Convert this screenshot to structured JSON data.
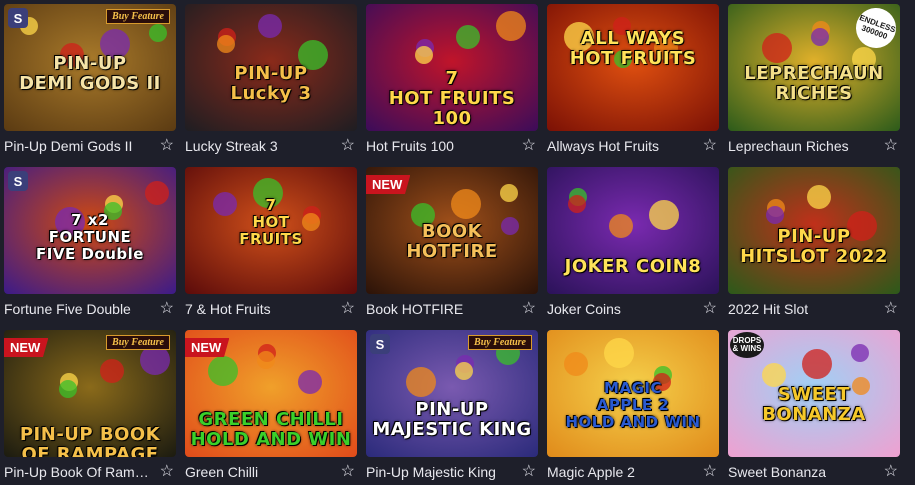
{
  "games": [
    {
      "title": "Pin-Up Demi Gods II",
      "logo": "PIN-UP\nDEMI GODS II",
      "badges": [
        "buy",
        "s"
      ],
      "bg": [
        "#5a3a12",
        "#a97a2a"
      ],
      "logoColor": "#f6e4a8",
      "logoY": 70
    },
    {
      "title": "Lucky Streak 3",
      "logo": "PIN-UP\nLucky 3",
      "badges": [],
      "bg": [
        "#1d1d22",
        "#8a2a1a"
      ],
      "logoColor": "#f5c04a",
      "logoY": 80
    },
    {
      "title": "Hot Fruits 100",
      "logo": "7\nHOT FRUITS 100",
      "badges": [],
      "bg": [
        "#3a0c5a",
        "#c0142a"
      ],
      "logoColor": "#ffd84a",
      "logoY": 85
    },
    {
      "title": "Allways Hot Fruits",
      "logo": "ALL WAYS\nHOT FRUITS",
      "badges": [],
      "bg": [
        "#7a1005",
        "#e05010"
      ],
      "logoColor": "#ffe35a",
      "logoY": 45
    },
    {
      "title": "Leprechaun Riches",
      "logo": "LEPRECHAUN\nRICHES",
      "badges": [
        "endless"
      ],
      "bg": [
        "#2a5a1a",
        "#e0b02a"
      ],
      "logoColor": "#f4e08a",
      "logoY": 80
    },
    {
      "title": "Fortune Five Double",
      "logo": "7 x2\nFORTUNE\nFIVE Double",
      "badges": [
        "s"
      ],
      "bg": [
        "#3a1a8a",
        "#d04a10"
      ],
      "logoColor": "#ffffff",
      "logoY": 70
    },
    {
      "title": "7 & Hot Fruits",
      "logo": "7\nHOT\nFRUITS",
      "badges": [],
      "bg": [
        "#5a0a0a",
        "#d0501a"
      ],
      "logoColor": "#ffd84a",
      "logoY": 55
    },
    {
      "title": "Book HOTFIRE",
      "logo": "BOOK\nHOTFIRE",
      "badges": [
        "new"
      ],
      "bg": [
        "#2a1208",
        "#a0501a"
      ],
      "logoColor": "#f5c05a",
      "logoY": 75
    },
    {
      "title": "Joker Coins",
      "logo": "JOKER COIN8",
      "badges": [],
      "bg": [
        "#2a1258",
        "#7a2ab0"
      ],
      "logoColor": "#ffe35a",
      "logoY": 100
    },
    {
      "title": "2022 Hit Slot",
      "logo": "PIN-UP\nHITSLOT 2022",
      "badges": [],
      "bg": [
        "#2a5a1a",
        "#c0301a"
      ],
      "logoColor": "#ffd84a",
      "logoY": 80
    },
    {
      "title": "Pin-Up Book Of Ramp…",
      "logo": "PIN-UP BOOK OF RAMPAGE",
      "badges": [
        "new",
        "buy"
      ],
      "bg": [
        "#1a1a10",
        "#8a6a1a"
      ],
      "logoColor": "#f5c04a",
      "logoY": 105
    },
    {
      "title": "Green Chilli",
      "logo": "GREEN CHILLI\nHOLD AND WIN",
      "badges": [
        "new"
      ],
      "bg": [
        "#e04a1a",
        "#f0a02a"
      ],
      "logoColor": "#3ad02a",
      "logoY": 100
    },
    {
      "title": "Pin-Up Majestic King",
      "logo": "PIN-UP\nMAJESTIC KING",
      "badges": [
        "buy",
        "s"
      ],
      "bg": [
        "#2a2a7a",
        "#7a5ab0"
      ],
      "logoColor": "#ffffff",
      "logoY": 90
    },
    {
      "title": "Magic Apple 2",
      "logo": "MAGIC\nAPPLE 2\nHOLD AND WIN",
      "badges": [],
      "bg": [
        "#e08a1a",
        "#f5d04a"
      ],
      "logoColor": "#2a5ad0",
      "logoY": 75
    },
    {
      "title": "Sweet Bonanza",
      "logo": "SWEET\nBONANZA",
      "badges": [
        "drops"
      ],
      "bg": [
        "#f0a0d0",
        "#a0d0f5"
      ],
      "logoColor": "#f5c82a",
      "logoY": 75
    }
  ],
  "labels": {
    "new": "NEW",
    "buy": "Buy Feature",
    "s": "S",
    "drops": "DROPS & WINS",
    "endless": "ENDLESS 300000"
  },
  "icons": {
    "favorite": "☆"
  }
}
